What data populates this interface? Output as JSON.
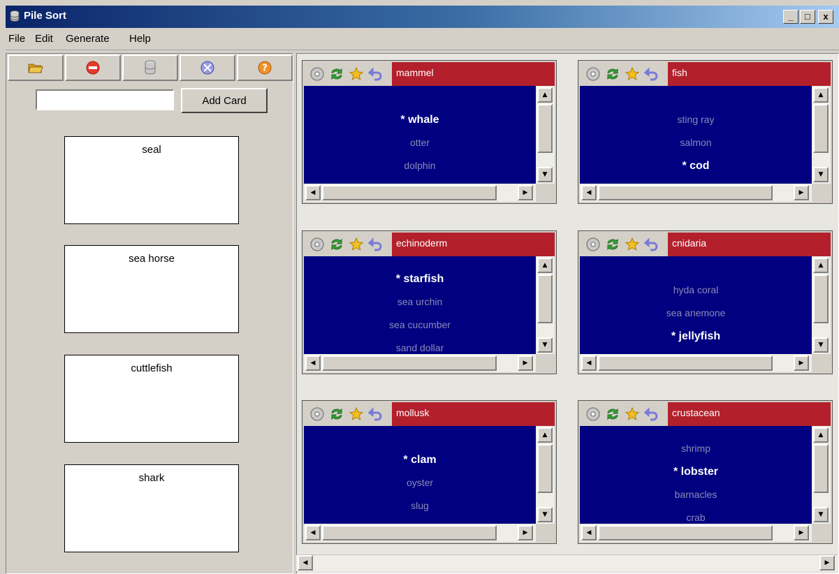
{
  "window": {
    "title": "Pile Sort",
    "minimize": "_",
    "maximize": "□",
    "close": "x"
  },
  "menu": [
    "File",
    "Edit",
    "Generate",
    "Help"
  ],
  "toolbar": [
    {
      "icon": "folder-open-icon",
      "color": "#e8b830"
    },
    {
      "icon": "stop-icon",
      "color": "#e83a2a"
    },
    {
      "icon": "database-icon",
      "color": "#9a9a9a"
    },
    {
      "icon": "compass-icon",
      "color": "#7c7ce0"
    },
    {
      "icon": "help-icon",
      "color": "#f0902a"
    }
  ],
  "add_card": {
    "input_value": "",
    "button_label": "Add Card"
  },
  "cards": [
    "seal",
    "sea horse",
    "cuttlefish",
    "shark"
  ],
  "piles": [
    {
      "label": "mammel",
      "items": [
        {
          "text": "* whale",
          "selected": true
        },
        {
          "text": "otter",
          "selected": false
        },
        {
          "text": "dolphin",
          "selected": false
        }
      ]
    },
    {
      "label": "fish",
      "items": [
        {
          "text": "sting ray",
          "selected": false
        },
        {
          "text": "salmon",
          "selected": false
        },
        {
          "text": "* cod",
          "selected": true
        }
      ]
    },
    {
      "label": "echinoderm",
      "items": [
        {
          "text": "* starfish",
          "selected": true
        },
        {
          "text": "sea urchin",
          "selected": false
        },
        {
          "text": "sea cucumber",
          "selected": false
        },
        {
          "text": "sand dollar",
          "selected": false
        }
      ]
    },
    {
      "label": "cnidaria",
      "items": [
        {
          "text": "hyda coral",
          "selected": false
        },
        {
          "text": "sea anemone",
          "selected": false
        },
        {
          "text": "* jellyfish",
          "selected": true
        }
      ]
    },
    {
      "label": "mollusk",
      "items": [
        {
          "text": "* clam",
          "selected": true
        },
        {
          "text": "oyster",
          "selected": false
        },
        {
          "text": "slug",
          "selected": false
        }
      ]
    },
    {
      "label": "crustacean",
      "items": [
        {
          "text": "shrimp",
          "selected": false
        },
        {
          "text": "* lobster",
          "selected": true
        },
        {
          "text": "barnacles",
          "selected": false
        },
        {
          "text": "crab",
          "selected": false
        }
      ]
    }
  ],
  "pile_icons": [
    "cd-icon",
    "refresh-icon",
    "star-icon",
    "undo-icon"
  ],
  "colors": {
    "pile_header": "#b3202c",
    "pile_list_bg": "#000080",
    "item_text": "#8a8ab8",
    "selected_text": "#ffffff"
  }
}
